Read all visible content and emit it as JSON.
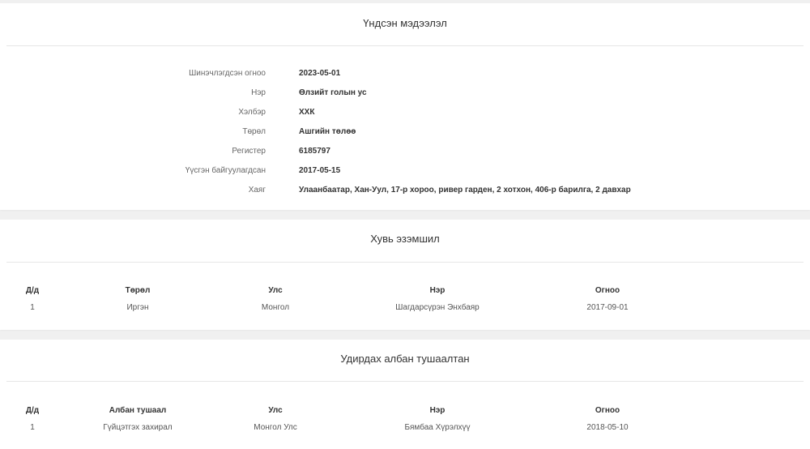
{
  "basic_info": {
    "title": "Үндсэн мэдээлэл",
    "rows": [
      {
        "label": "Шинэчлэгдсэн огноо",
        "value": "2023-05-01"
      },
      {
        "label": "Нэр",
        "value": "Өлзийт голын ус"
      },
      {
        "label": "Хэлбэр",
        "value": "ХХК"
      },
      {
        "label": "Төрөл",
        "value": "Ашгийн төлөө"
      },
      {
        "label": "Регистер",
        "value": "6185797"
      },
      {
        "label": "Үүсгэн байгуулагдсан",
        "value": "2017-05-15"
      },
      {
        "label": "Хаяг",
        "value": "Улаанбаатар, Хан-Уул, 17-р хороо, ривер гарден, 2 хотхон, 406-р барилга, 2 давхар"
      }
    ]
  },
  "ownership": {
    "title": "Хувь эзэмшил",
    "headers": [
      "Д/д",
      "Төрөл",
      "Улс",
      "Нэр",
      "Огноо"
    ],
    "rows": [
      [
        "1",
        "Иргэн",
        "Монгол",
        "Шагдарсүрэн Энхбаяр",
        "2017-09-01"
      ]
    ]
  },
  "management": {
    "title": "Удирдах албан тушаалтан",
    "headers": [
      "Д/д",
      "Албан тушаал",
      "Улс",
      "Нэр",
      "Огноо"
    ],
    "rows": [
      [
        "1",
        "Гүйцэтгэх захирал",
        "Монгол Улс",
        "Бямбаа Хүрэлхүү",
        "2018-05-10"
      ]
    ]
  }
}
